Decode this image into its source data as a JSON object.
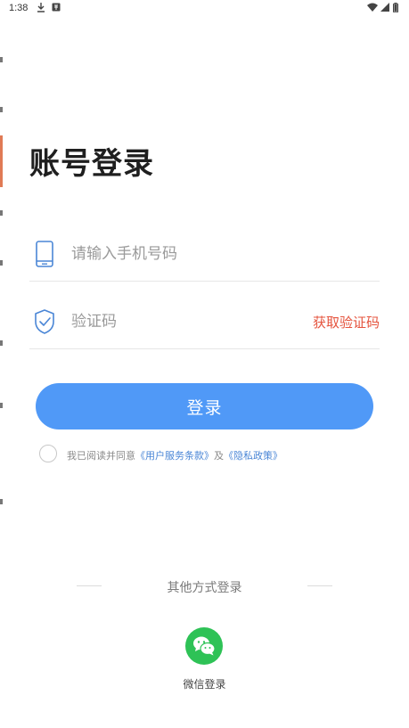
{
  "status_bar": {
    "time": "1:38",
    "icons": [
      "download-icon",
      "notification-icon",
      "wifi-icon",
      "signal-icon",
      "battery-icon"
    ]
  },
  "login": {
    "title": "账号登录",
    "phone_placeholder": "请输入手机号码",
    "code_placeholder": "验证码",
    "get_code_label": "获取验证码",
    "login_button_label": "登录",
    "agreement": {
      "prefix": "我已阅读并同意",
      "terms_link": "《用户服务条款》",
      "and": "及",
      "privacy_link": "《隐私政策》"
    }
  },
  "other_login": {
    "title": "其他方式登录",
    "wechat_label": "微信登录"
  },
  "colors": {
    "accent": "#5099f7",
    "link": "#4a86d6",
    "get_code": "#e5533d",
    "wechat": "#2ec256"
  }
}
